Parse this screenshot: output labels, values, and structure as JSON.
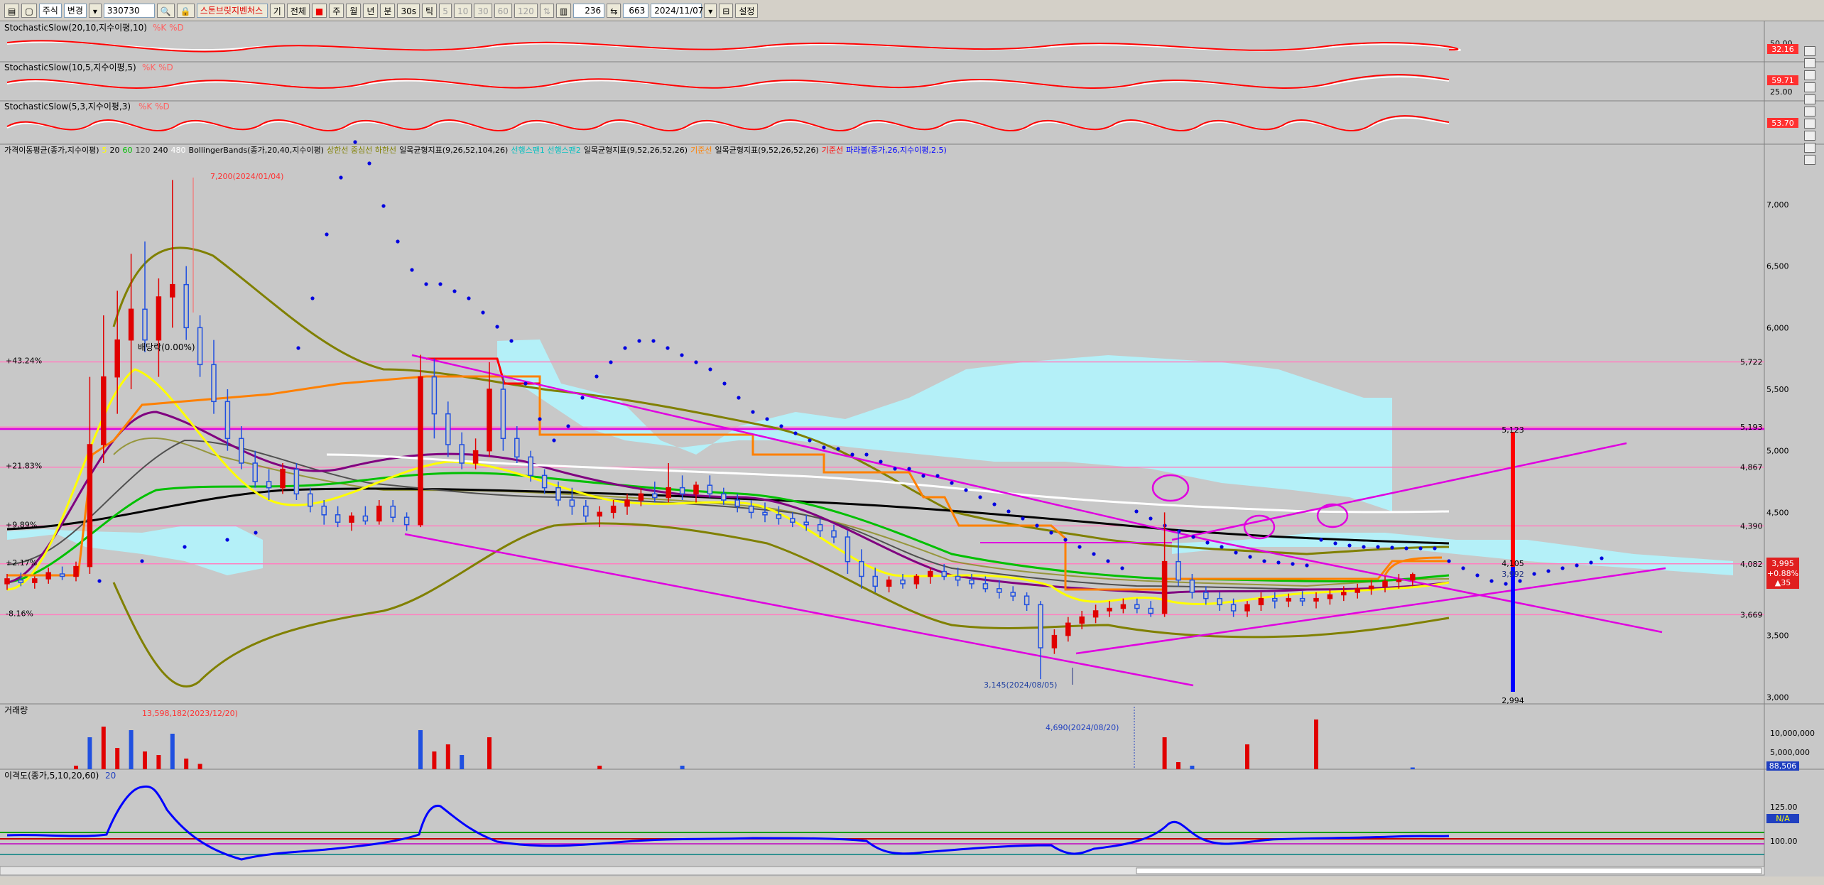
{
  "toolbar": {
    "market": "주식",
    "change": "변경",
    "code": "330730",
    "stock_name": "스톤브릿지벤처스",
    "period_buttons": [
      "기",
      "전체"
    ],
    "tf_buttons": [
      "주",
      "월",
      "년",
      "분",
      "30s",
      "틱"
    ],
    "interval_buttons": [
      "5",
      "10",
      "30",
      "60",
      "120"
    ],
    "count": "236",
    "bars": "663",
    "date": "2024/11/07",
    "settings": "설정"
  },
  "panels": {
    "stoch1": {
      "label": "StochasticSlow(20,10,지수이평,10)",
      "legend": "%K %D",
      "value": "32.16",
      "ticks": [
        "50.00"
      ]
    },
    "stoch2": {
      "label": "StochasticSlow(10,5,지수이평,5)",
      "legend": "%K %D",
      "value": "59.71",
      "ticks": [
        "25.00"
      ]
    },
    "stoch3": {
      "label": "StochasticSlow(5,3,지수이평,3)",
      "legend": "%K %D",
      "value": "53.70",
      "ticks": []
    },
    "main_legend": [
      {
        "text": "가격이동평균(종가,지수이평)",
        "color": "#000000"
      },
      {
        "text": "5",
        "color": "#ffff00"
      },
      {
        "text": "20",
        "color": "#000000"
      },
      {
        "text": "60",
        "color": "#00c000"
      },
      {
        "text": "120",
        "color": "#404040"
      },
      {
        "text": "240",
        "color": "#000000"
      },
      {
        "text": "480",
        "color": "#ffffff"
      },
      {
        "text": "BollingerBands(종가,20,40,지수이평)",
        "color": "#000000"
      },
      {
        "text": "상한선 중심선 하한선",
        "color": "#808000"
      },
      {
        "text": "일목균형지표(9,26,52,104,26)",
        "color": "#000000"
      },
      {
        "text": "선행스팬1 선행스팬2",
        "color": "#00c0c0"
      },
      {
        "text": "일목균형지표(9,52,26,52,26)",
        "color": "#000000"
      },
      {
        "text": "기준선",
        "color": "#ff8000"
      },
      {
        "text": "일목균형지표(9,52,26,52,26)",
        "color": "#000000"
      },
      {
        "text": "기준선",
        "color": "#ff0000"
      },
      {
        "text": "파라볼(종가,26,지수이평,2.5)",
        "color": "#0000ff"
      }
    ],
    "volume": {
      "label": "거래량",
      "max_label": "13,598,182(2023/12/20)",
      "aug_label": "4,690(2024/08/20)",
      "ticks": [
        "10,000,000",
        "5,000,000"
      ],
      "value": "88,506"
    },
    "disparity": {
      "label": "이격도(종가,5,10,20,60)",
      "legend_num": "20",
      "ticks": [
        "125.00",
        "100.00"
      ],
      "value": "N/A"
    }
  },
  "annotations": {
    "high": "7,200(2024/01/04)",
    "low": "3,145(2024/08/05)",
    "dividend": "배당락(0.00%)",
    "proj_high": "5,123",
    "proj_low": "2,994",
    "proj_mid": "4,105",
    "proj_mid2": "3,992",
    "current_price": "3,995",
    "current_change": "+0.88%",
    "current_diff": "▲35"
  },
  "percent_labels": [
    "+43.24%",
    "+21.83%",
    "+9.89%",
    "+2.17%",
    "-8.16%"
  ],
  "price_right_labels": [
    "5,722",
    "5,193",
    "4,867",
    "4,390",
    "4,082",
    "3,669"
  ],
  "chart_data": {
    "type": "candlestick",
    "y_ticks": [
      7000,
      6500,
      6000,
      5500,
      5000,
      4500,
      3500,
      3000
    ],
    "ylim": [
      2950,
      7450
    ],
    "h_levels": [
      5722,
      5193,
      4867,
      4390,
      4082,
      3669
    ],
    "candles": [
      [
        0,
        3920,
        4000,
        3870,
        3960
      ],
      [
        4,
        3950,
        4010,
        3900,
        3930
      ],
      [
        8,
        3930,
        3980,
        3880,
        3960
      ],
      [
        12,
        3960,
        4050,
        3920,
        4010
      ],
      [
        16,
        4000,
        4060,
        3950,
        3980
      ],
      [
        20,
        3980,
        4100,
        3940,
        4060
      ],
      [
        24,
        4060,
        5600,
        4000,
        5050
      ],
      [
        28,
        5050,
        6100,
        4900,
        5600
      ],
      [
        32,
        5600,
        6300,
        5300,
        5900
      ],
      [
        36,
        5900,
        6600,
        5500,
        6150
      ],
      [
        40,
        6150,
        6700,
        5800,
        5900
      ],
      [
        44,
        5900,
        6400,
        5600,
        6250
      ],
      [
        48,
        6250,
        7200,
        6000,
        6350
      ],
      [
        52,
        6350,
        6500,
        5900,
        6000
      ],
      [
        56,
        6000,
        6100,
        5600,
        5700
      ],
      [
        60,
        5700,
        5900,
        5300,
        5400
      ],
      [
        64,
        5400,
        5500,
        5000,
        5100
      ],
      [
        68,
        5100,
        5200,
        4850,
        4900
      ],
      [
        72,
        4900,
        5000,
        4700,
        4750
      ],
      [
        76,
        4750,
        4850,
        4600,
        4700
      ],
      [
        80,
        4700,
        4900,
        4650,
        4850
      ],
      [
        84,
        4850,
        4900,
        4600,
        4650
      ],
      [
        88,
        4650,
        4700,
        4500,
        4550
      ],
      [
        92,
        4550,
        4600,
        4400,
        4480
      ],
      [
        96,
        4480,
        4550,
        4380,
        4420
      ],
      [
        100,
        4420,
        4500,
        4350,
        4470
      ],
      [
        104,
        4470,
        4550,
        4400,
        4430
      ],
      [
        108,
        4430,
        4600,
        4400,
        4550
      ],
      [
        112,
        4550,
        4600,
        4420,
        4460
      ],
      [
        116,
        4460,
        4500,
        4350,
        4400
      ],
      [
        120,
        4400,
        5780,
        4380,
        5600
      ],
      [
        124,
        5600,
        5750,
        5100,
        5300
      ],
      [
        128,
        5300,
        5400,
        4950,
        5050
      ],
      [
        132,
        5050,
        5150,
        4850,
        4900
      ],
      [
        136,
        4900,
        5100,
        4850,
        5000
      ],
      [
        140,
        5000,
        5720,
        4950,
        5500
      ],
      [
        144,
        5500,
        5600,
        5000,
        5100
      ],
      [
        148,
        5100,
        5200,
        4900,
        4950
      ],
      [
        152,
        4950,
        5000,
        4750,
        4800
      ],
      [
        156,
        4800,
        4850,
        4650,
        4700
      ],
      [
        160,
        4700,
        4750,
        4550,
        4600
      ],
      [
        164,
        4600,
        4700,
        4480,
        4550
      ],
      [
        168,
        4550,
        4600,
        4420,
        4470
      ],
      [
        172,
        4470,
        4550,
        4380,
        4500
      ],
      [
        176,
        4500,
        4600,
        4450,
        4550
      ],
      [
        180,
        4550,
        4650,
        4480,
        4600
      ],
      [
        184,
        4600,
        4700,
        4550,
        4650
      ],
      [
        188,
        4650,
        4750,
        4580,
        4620
      ],
      [
        192,
        4620,
        4900,
        4580,
        4700
      ],
      [
        196,
        4700,
        4800,
        4600,
        4650
      ],
      [
        200,
        4650,
        4750,
        4580,
        4720
      ],
      [
        204,
        4720,
        4800,
        4620,
        4650
      ],
      [
        208,
        4650,
        4700,
        4560,
        4600
      ],
      [
        212,
        4600,
        4650,
        4500,
        4550
      ],
      [
        216,
        4550,
        4600,
        4450,
        4500
      ],
      [
        220,
        4500,
        4580,
        4420,
        4480
      ],
      [
        224,
        4480,
        4550,
        4400,
        4450
      ],
      [
        228,
        4450,
        4500,
        4380,
        4420
      ],
      [
        232,
        4420,
        4480,
        4350,
        4400
      ],
      [
        236,
        4400,
        4450,
        4300,
        4350
      ],
      [
        240,
        4350,
        4400,
        4250,
        4300
      ],
      [
        244,
        4300,
        4350,
        4000,
        4100
      ],
      [
        248,
        4100,
        4200,
        3880,
        3980
      ],
      [
        252,
        3980,
        4050,
        3850,
        3900
      ],
      [
        256,
        3900,
        3980,
        3850,
        3950
      ],
      [
        260,
        3950,
        4000,
        3880,
        3920
      ],
      [
        264,
        3920,
        4000,
        3880,
        3980
      ],
      [
        268,
        3980,
        4050,
        3920,
        4020
      ],
      [
        272,
        4020,
        4080,
        3950,
        3980
      ],
      [
        276,
        3980,
        4050,
        3900,
        3950
      ],
      [
        280,
        3950,
        4000,
        3880,
        3920
      ],
      [
        284,
        3920,
        3980,
        3850,
        3880
      ],
      [
        288,
        3880,
        3950,
        3800,
        3850
      ],
      [
        292,
        3850,
        3900,
        3780,
        3820
      ],
      [
        296,
        3820,
        3850,
        3700,
        3750
      ],
      [
        300,
        3750,
        3780,
        3145,
        3400
      ],
      [
        304,
        3400,
        3550,
        3350,
        3500
      ],
      [
        308,
        3500,
        3650,
        3450,
        3600
      ],
      [
        312,
        3600,
        3700,
        3550,
        3650
      ],
      [
        316,
        3650,
        3750,
        3600,
        3700
      ],
      [
        320,
        3700,
        3780,
        3650,
        3720
      ],
      [
        324,
        3720,
        3800,
        3680,
        3750
      ],
      [
        328,
        3750,
        3800,
        3680,
        3720
      ],
      [
        332,
        3720,
        3780,
        3650,
        3680
      ],
      [
        336,
        3680,
        4500,
        3650,
        4100
      ],
      [
        340,
        4100,
        4350,
        3900,
        3950
      ],
      [
        344,
        3950,
        4000,
        3800,
        3850
      ],
      [
        348,
        3850,
        3900,
        3750,
        3800
      ],
      [
        352,
        3800,
        3850,
        3700,
        3750
      ],
      [
        356,
        3750,
        3800,
        3650,
        3700
      ],
      [
        360,
        3700,
        3780,
        3650,
        3750
      ],
      [
        364,
        3750,
        3850,
        3700,
        3800
      ],
      [
        368,
        3800,
        3850,
        3720,
        3780
      ],
      [
        372,
        3780,
        3840,
        3730,
        3800
      ],
      [
        376,
        3800,
        3860,
        3740,
        3780
      ],
      [
        380,
        3780,
        3850,
        3720,
        3800
      ],
      [
        384,
        3800,
        3880,
        3750,
        3830
      ],
      [
        388,
        3830,
        3900,
        3780,
        3850
      ],
      [
        392,
        3850,
        3920,
        3800,
        3880
      ],
      [
        396,
        3880,
        3950,
        3830,
        3900
      ],
      [
        400,
        3900,
        3980,
        3850,
        3940
      ],
      [
        404,
        3940,
        4000,
        3880,
        3950
      ],
      [
        408,
        3950,
        4010,
        3900,
        3995
      ]
    ],
    "volume": [
      [
        20,
        1
      ],
      [
        24,
        9
      ],
      [
        28,
        12
      ],
      [
        32,
        6
      ],
      [
        36,
        11
      ],
      [
        40,
        5
      ],
      [
        44,
        4
      ],
      [
        48,
        10
      ],
      [
        52,
        3
      ],
      [
        56,
        1.5
      ],
      [
        120,
        11
      ],
      [
        124,
        5
      ],
      [
        128,
        7
      ],
      [
        132,
        4
      ],
      [
        140,
        9
      ],
      [
        172,
        1
      ],
      [
        196,
        1
      ],
      [
        336,
        9
      ],
      [
        340,
        2
      ],
      [
        344,
        1
      ],
      [
        360,
        7
      ],
      [
        380,
        14
      ],
      [
        408,
        0.5
      ]
    ]
  }
}
